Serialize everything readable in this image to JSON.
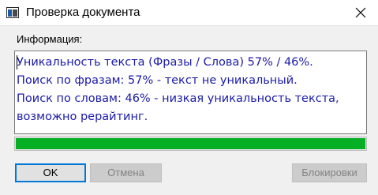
{
  "window": {
    "title": "Проверка документа",
    "icon": "app-window-icon",
    "close_icon": "close-icon"
  },
  "info": {
    "label": "Информация:",
    "lines": [
      "Уникальность текста (Фразы / Слова) 57% / 46%.",
      "Поиск по фразам: 57% - текст не уникальный.",
      "Поиск по словам: 46% - низкая уникальность текста,",
      "возможно рерайтинг."
    ],
    "text_color": "#1a1aa8"
  },
  "progress": {
    "value_percent": 100,
    "color": "#06b025"
  },
  "buttons": {
    "ok": "OK",
    "cancel": "Отмена",
    "locks": "Блокировки"
  }
}
